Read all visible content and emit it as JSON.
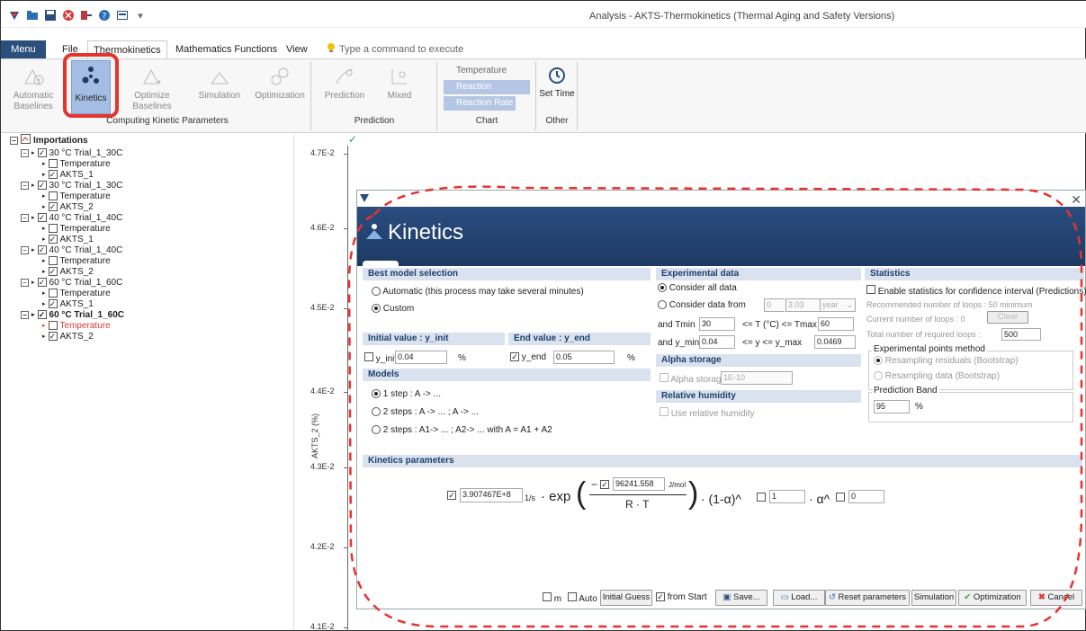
{
  "window": {
    "title": "Analysis - AKTS-Thermokinetics (Thermal Aging and Safety Versions)"
  },
  "tabs": {
    "menu": "Menu",
    "file": "File",
    "thermokinetics": "Thermokinetics",
    "math": "Mathematics Functions",
    "view": "View"
  },
  "command_search": {
    "placeholder": "Type a command to execute"
  },
  "ribbon": {
    "automatic_baselines": "Automatic Baselines",
    "kinetics": "Kinetics",
    "optimize_baselines": "Optimize Baselines",
    "simulation": "Simulation",
    "optimization": "Optimization",
    "group_computing": "Computing Kinetic Parameters",
    "prediction": "Prediction",
    "mixed": "Mixed",
    "group_prediction": "Prediction",
    "chart_temperature": "Temperature",
    "chart_reaction_progress": "Reaction Progress",
    "chart_reaction_rate": "Reaction Rate",
    "group_chart": "Chart",
    "set_time": "Set Time",
    "group_other": "Other"
  },
  "tree": {
    "root": "Importations",
    "items": [
      {
        "label": "30 °C Trial_1_30C",
        "children": [
          "Temperature",
          "AKTS_1"
        ]
      },
      {
        "label": "30 °C Trial_1_30C",
        "children": [
          "Temperature",
          "AKTS_2"
        ]
      },
      {
        "label": "40 °C Trial_1_40C",
        "children": [
          "Temperature",
          "AKTS_1"
        ]
      },
      {
        "label": "40 °C Trial_1_40C",
        "children": [
          "Temperature",
          "AKTS_2"
        ]
      },
      {
        "label": "60 °C Trial_1_60C",
        "children": [
          "Temperature",
          "AKTS_1"
        ]
      },
      {
        "label": "60 °C Trial_1_60C",
        "children": [
          "Temperature",
          "AKTS_2"
        ]
      }
    ]
  },
  "plot": {
    "y_ticks": [
      "4.7E-2",
      "4.6E-2",
      "4.5E-2",
      "4.4E-2",
      "4.3E-2",
      "4.2E-2",
      "4.1E-2"
    ],
    "y_label": "AKTS_2 (%)"
  },
  "dialog": {
    "title": "Kinetics",
    "best_model": {
      "header": "Best model selection",
      "automatic": "Automatic (this process may take several minutes)",
      "custom": "Custom"
    },
    "initial": {
      "header": "Initial value : y_init",
      "check": "y_init",
      "value": "0.04",
      "unit": "%"
    },
    "end": {
      "header": "End value : y_end",
      "check": "y_end",
      "value": "0.05",
      "unit": "%"
    },
    "models": {
      "header": "Models",
      "m1": "1 step : A -> ...",
      "m2": "2 steps : A -> ... ; A -> ...",
      "m3": "2 steps : A1-> ... ; A2-> ... with A = A1 + A2"
    },
    "experimental": {
      "header": "Experimental data",
      "all": "Consider all data",
      "from": "Consider data from",
      "from_value": "0",
      "until": "until",
      "until_value": "3.03",
      "unit": "year",
      "tmin_label": "and Tmin",
      "tmin": "30",
      "t_range": "<= T (°C) <= Tmax",
      "tmax": "60",
      "ymin_label": "and y_min",
      "ymin": "0.04",
      "y_range": "<= y <= y_max",
      "ymax": "0.0469"
    },
    "alpha": {
      "header": "Alpha storage",
      "check": "Alpha storage",
      "value": "1E-10"
    },
    "humidity": {
      "header": "Relative humidity",
      "check": "Use relative humidity"
    },
    "statistics": {
      "header": "Statistics",
      "enable": "Enable statistics for confidence interval (Predictions)",
      "recommended": "Recommended number of loops : 50 minimum",
      "current": "Current number of loops : 0",
      "clear": "Clear",
      "total": "Total number of required loops :",
      "total_value": "500",
      "method_title": "Experimental points method",
      "resid": "Resampling residuals (Bootstrap)",
      "data": "Resampling data (Bootstrap)",
      "band_title": "Prediction Band",
      "band_value": "95",
      "band_unit": "%"
    },
    "kinetic_params": {
      "header": "Kinetics parameters",
      "a_value": "3.907467E+8",
      "a_unit": "1/s",
      "exp": "exp",
      "e_value": "96241.558",
      "e_unit": "J/mol",
      "rt": "R · T",
      "one_minus": "· (1-α)^",
      "n_value": "1",
      "alpha_pow": "· α^",
      "m_value": "0"
    },
    "footer": {
      "m": "m",
      "auto": "Auto",
      "initial_guess": "Initial Guess",
      "from_start": "from Start",
      "save": "Save...",
      "load": "Load...",
      "reset": "Reset parameters",
      "simulation": "Simulation",
      "optimization": "Optimization",
      "cancel": "Cancel"
    }
  },
  "colors": {
    "accent": "#2b4f7c",
    "highlight": "#e8322e",
    "selected": "#a3bde3"
  }
}
